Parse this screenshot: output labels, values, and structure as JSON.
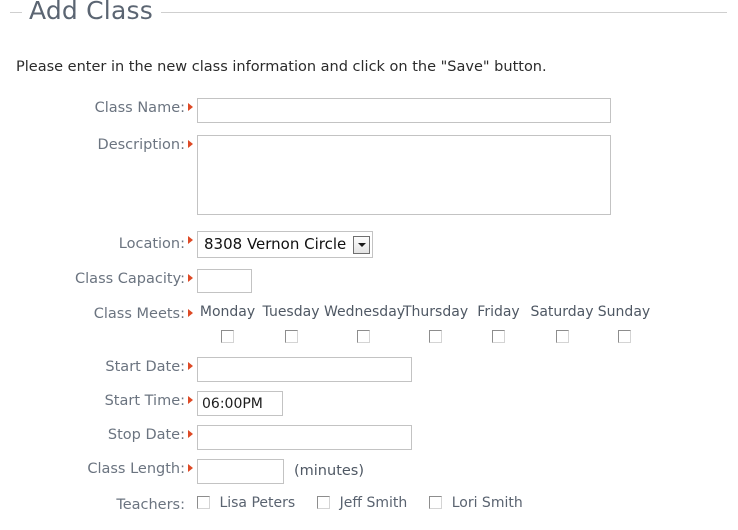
{
  "panel": {
    "legend": "Add Class",
    "intro": "Please enter in the new class information and click on the \"Save\" button."
  },
  "form": {
    "fields": {
      "class_name": {
        "label": "Class Name:",
        "value": "",
        "required": true
      },
      "description": {
        "label": "Description:",
        "value": "",
        "required": true
      },
      "location": {
        "label": "Location:",
        "value": "8308 Vernon Circle",
        "required": true
      },
      "class_capacity": {
        "label": "Class Capacity:",
        "value": "",
        "required": true
      },
      "class_meets": {
        "label": "Class Meets:",
        "required": true
      },
      "start_date": {
        "label": "Start Date:",
        "value": "",
        "required": true
      },
      "start_time": {
        "label": "Start Time:",
        "value": "06:00PM",
        "required": true
      },
      "stop_date": {
        "label": "Stop Date:",
        "value": "",
        "required": true
      },
      "class_length": {
        "label": "Class Length:",
        "value": "",
        "required": true,
        "suffix": "(minutes)"
      },
      "teachers": {
        "label": "Teachers:",
        "required": false
      }
    },
    "days": [
      {
        "label": "Monday",
        "checked": false
      },
      {
        "label": "Tuesday",
        "checked": false
      },
      {
        "label": "Wednesday",
        "checked": false
      },
      {
        "label": "Thursday",
        "checked": false
      },
      {
        "label": "Friday",
        "checked": false
      },
      {
        "label": "Saturday",
        "checked": false
      },
      {
        "label": "Sunday",
        "checked": false
      }
    ],
    "teachers": [
      {
        "name": "Lisa Peters",
        "checked": false
      },
      {
        "name": "Jeff Smith",
        "checked": false
      },
      {
        "name": "Lori Smith",
        "checked": false
      }
    ]
  },
  "icons": {
    "required_marker": "required-triangle-icon",
    "dropdown_arrow": "chevron-down-icon",
    "scroll_up": "scroll-up-arrow-icon",
    "scroll_down": "scroll-down-arrow-icon"
  },
  "colors": {
    "required": "#dd4a26",
    "label": "#6b7480",
    "legend": "#5b6572",
    "border": "#c3c3c3"
  }
}
